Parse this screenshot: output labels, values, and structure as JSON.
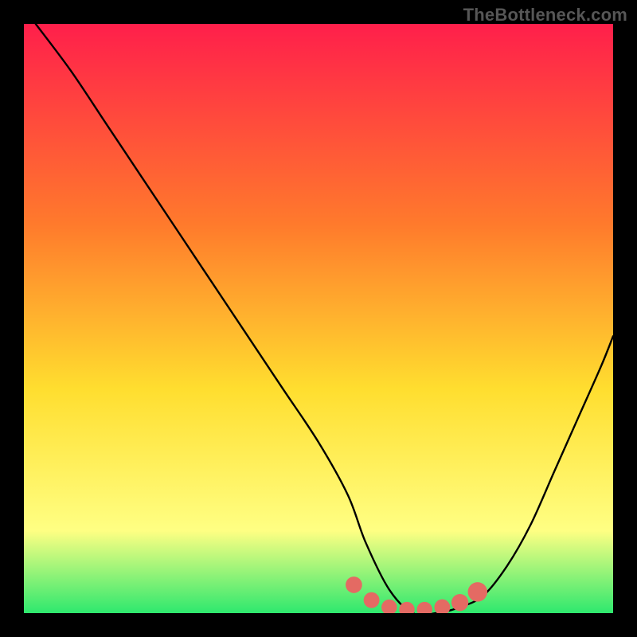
{
  "attribution": "TheBottleneck.com",
  "chart_data": {
    "type": "line",
    "title": "",
    "xlabel": "",
    "ylabel": "",
    "xlim": [
      0,
      100
    ],
    "ylim": [
      0,
      100
    ],
    "background_gradient": {
      "top": "#FF1F4B",
      "via1": "#FF7A2C",
      "via2": "#FFDE2F",
      "via3": "#FFFF83",
      "bottom": "#2EE86E"
    },
    "series": [
      {
        "name": "bottleneck-curve",
        "x": [
          2,
          8,
          14,
          20,
          26,
          32,
          38,
          44,
          50,
          55,
          58,
          62,
          66,
          70,
          74,
          78,
          82,
          86,
          90,
          94,
          98,
          100
        ],
        "y": [
          100,
          92,
          83,
          74,
          65,
          56,
          47,
          38,
          29,
          20,
          12,
          4,
          0,
          0,
          1,
          3,
          8,
          15,
          24,
          33,
          42,
          47
        ]
      }
    ],
    "markers": {
      "name": "highlight-band",
      "color": "#E46A63",
      "x": [
        56,
        59,
        62,
        65,
        68,
        71,
        74,
        77
      ],
      "y": [
        4.8,
        2.2,
        1.0,
        0.6,
        0.6,
        1.0,
        1.8,
        3.6
      ],
      "radius": [
        4.2,
        3.8,
        3.6,
        3.6,
        3.6,
        3.8,
        4.5,
        6.0
      ]
    }
  }
}
